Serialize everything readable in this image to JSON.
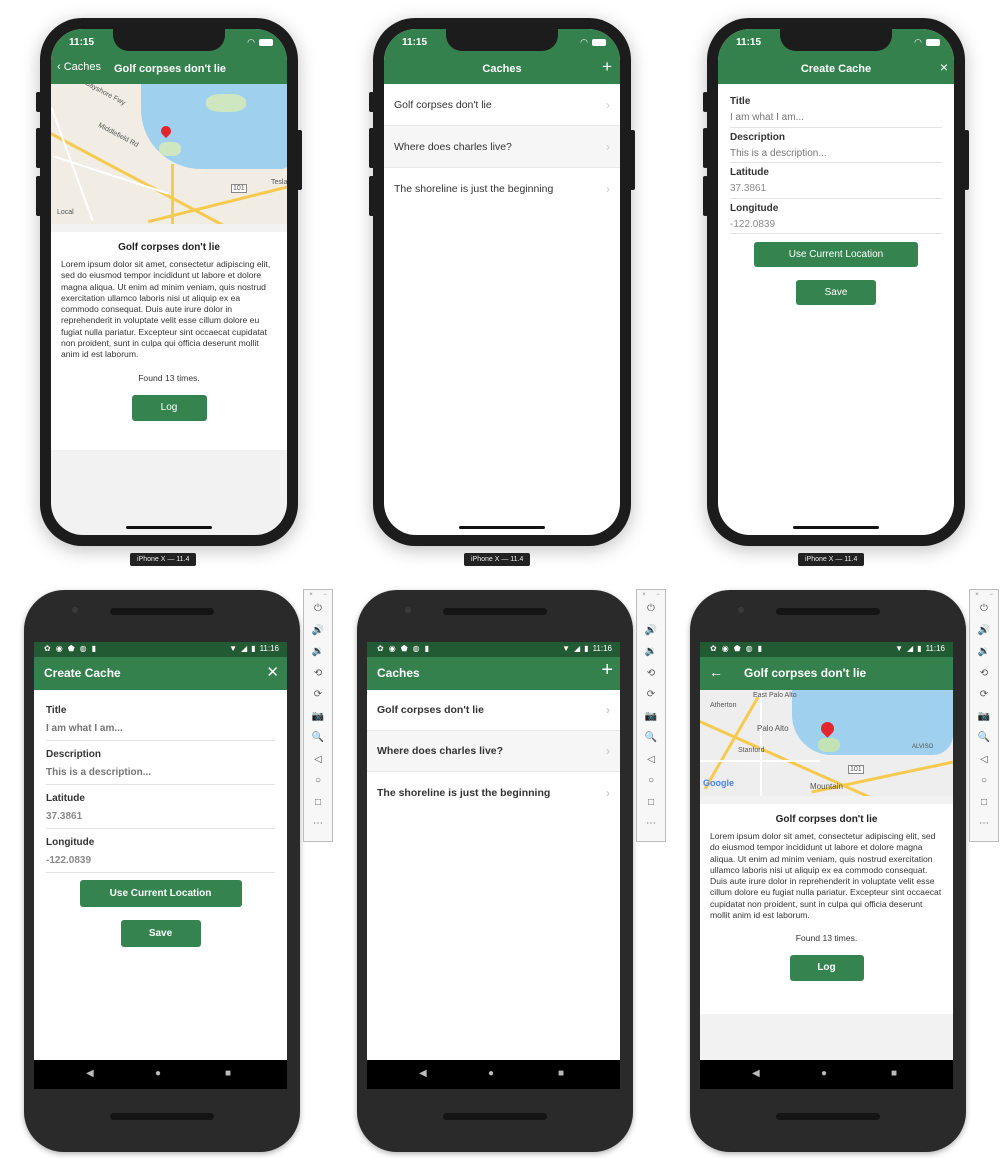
{
  "ios": {
    "time": "11:15",
    "device_label": "iPhone X — 11.4",
    "detail_screen": {
      "back_label": "Caches",
      "title": "Golf corpses don't lie",
      "map_labels": [
        "Bayshore Fwy",
        "Middlefield Rd",
        "101",
        "Local",
        "Tesla"
      ],
      "cache_title": "Golf corpses don't lie",
      "description": "Lorem ipsum dolor sit amet, consectetur adipiscing elit, sed do eiusmod tempor incididunt ut labore et dolore magna aliqua. Ut enim ad minim veniam, quis nostrud exercitation ullamco laboris nisi ut aliquip ex ea commodo consequat. Duis aute irure dolor in reprehenderit in voluptate velit esse cillum dolore eu fugiat nulla pariatur. Excepteur sint occaecat cupidatat non proident, sunt in culpa qui officia deserunt mollit anim id est laborum.",
      "found_text": "Found 13 times.",
      "log_label": "Log"
    },
    "list_screen": {
      "title": "Caches",
      "add_icon": "+",
      "items": [
        {
          "label": "Golf corpses don't lie"
        },
        {
          "label": "Where does charles live?"
        },
        {
          "label": "The shoreline is just the beginning"
        }
      ]
    },
    "create_screen": {
      "title": "Create Cache",
      "close_icon": "×",
      "fields": [
        {
          "label": "Title",
          "placeholder": "I am what I am...",
          "value": ""
        },
        {
          "label": "Description",
          "placeholder": "This is a description...",
          "value": ""
        },
        {
          "label": "Latitude",
          "placeholder": "",
          "value": "37.3861"
        },
        {
          "label": "Longitude",
          "placeholder": "",
          "value": "-122.0839"
        }
      ],
      "use_location_label": "Use Current Location",
      "save_label": "Save"
    }
  },
  "android": {
    "time": "11:16",
    "create_screen": {
      "title": "Create Cache",
      "close_icon": "✕",
      "fields": [
        {
          "label": "Title",
          "placeholder": "I am what I am...",
          "value": ""
        },
        {
          "label": "Description",
          "placeholder": "This is a description...",
          "value": ""
        },
        {
          "label": "Latitude",
          "placeholder": "",
          "value": "37.3861"
        },
        {
          "label": "Longitude",
          "placeholder": "",
          "value": "-122.0839"
        }
      ],
      "use_location_label": "Use Current Location",
      "save_label": "Save"
    },
    "list_screen": {
      "title": "Caches",
      "add_icon": "+",
      "items": [
        {
          "label": "Golf corpses don't lie"
        },
        {
          "label": "Where does charles live?"
        },
        {
          "label": "The shoreline is just the beginning"
        }
      ]
    },
    "detail_screen": {
      "title": "Golf corpses don't lie",
      "back_icon": "←",
      "map_labels": [
        "East Palo Alto",
        "Atherton",
        "Palo Alto",
        "Stanford",
        "Mountain",
        "101",
        "Google",
        "ALVISO"
      ],
      "cache_title": "Golf corpses don't lie",
      "description": "Lorem ipsum dolor sit amet, consectetur adipiscing elit, sed do eiusmod tempor incididunt ut labore et dolore magna aliqua. Ut enim ad minim veniam, quis nostrud exercitation ullamco laboris nisi ut aliquip ex ea commodo consequat. Duis aute irure dolor in reprehenderit in voluptate velit esse cillum dolore eu fugiat nulla pariatur. Excepteur sint occaecat cupidatat non proident, sunt in culpa qui officia deserunt mollit anim id est laborum.",
      "found_text": "Found 13 times.",
      "log_label": "Log"
    },
    "nav": {
      "back": "◀",
      "home": "●",
      "recents": "■"
    },
    "emulator_toolbar": {
      "window_controls": [
        "×",
        "−"
      ],
      "tools": [
        {
          "name": "power",
          "glyph": "⏻"
        },
        {
          "name": "volume-up",
          "glyph": "🔊"
        },
        {
          "name": "volume-down",
          "glyph": "🔉"
        },
        {
          "name": "rotate-left",
          "glyph": "⟲"
        },
        {
          "name": "rotate-right",
          "glyph": "⟳"
        },
        {
          "name": "screenshot",
          "glyph": "📷"
        },
        {
          "name": "zoom",
          "glyph": "🔍"
        },
        {
          "name": "back",
          "glyph": "◁"
        },
        {
          "name": "home",
          "glyph": "○"
        },
        {
          "name": "overview",
          "glyph": "□"
        },
        {
          "name": "more",
          "glyph": "⋯"
        }
      ]
    }
  },
  "colors": {
    "brand_green": "#34814d",
    "status_bar_green": "#225a34",
    "button_green": "#35834f"
  }
}
